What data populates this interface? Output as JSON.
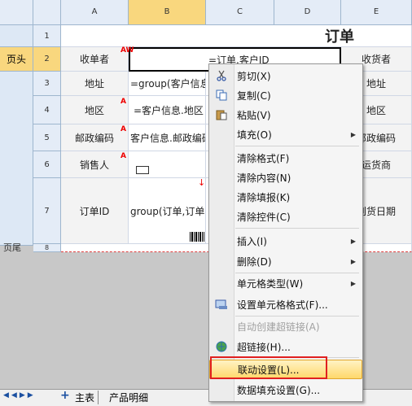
{
  "columns": [
    "A",
    "B",
    "C",
    "D",
    "E"
  ],
  "rows": [
    "1",
    "2",
    "3",
    "4",
    "5",
    "6",
    "7",
    "8"
  ],
  "band": {
    "header_label": "页头",
    "footer_label": "页尾"
  },
  "title": "订单",
  "cells": {
    "r2_a": "收单者",
    "r2_c": "=订单.客户ID",
    "r2_e": "收货者",
    "r3_a": "地址",
    "r3_b": "=group(客户信息",
    "r3_e": "地址",
    "r4_a": "地区",
    "r4_b": "=客户信息.地区",
    "r4_e": "地区",
    "r5_a": "邮政编码",
    "r5_b": "客户信息.邮政编码",
    "r5_e": "邮政编码",
    "r6_a": "销售人",
    "r6_e": "运货商",
    "r7_a": "订单ID",
    "r7_b": "group(订单,订单I",
    "r7_e": "到货日期"
  },
  "markers": {
    "aw": "AW",
    "a": "A"
  },
  "menu": {
    "items": [
      {
        "label": "剪切(X)",
        "icon": "scissors-icon"
      },
      {
        "label": "复制(C)",
        "icon": "copy-icon"
      },
      {
        "label": "粘贴(V)",
        "icon": "paste-icon"
      },
      {
        "label": "填充(O)"
      },
      {
        "label": "清除格式(F)"
      },
      {
        "label": "清除内容(N)"
      },
      {
        "label": "清除填报(K)"
      },
      {
        "label": "清除控件(C)"
      },
      {
        "label": "插入(I)"
      },
      {
        "label": "删除(D)"
      },
      {
        "label": "单元格类型(W)"
      },
      {
        "label": "设置单元格格式(F)...",
        "icon": "format-cells-icon"
      },
      {
        "label": "自动创建超链接(A)"
      },
      {
        "label": "超链接(H)...",
        "icon": "hyperlink-icon"
      },
      {
        "label": "联动设置(L)..."
      },
      {
        "label": "数据填充设置(G)..."
      }
    ]
  },
  "tabs": {
    "main": "主表",
    "detail": "产品明细"
  },
  "colors": {
    "highlight_border": "#e02020",
    "selected_header": "#f9d77e"
  }
}
